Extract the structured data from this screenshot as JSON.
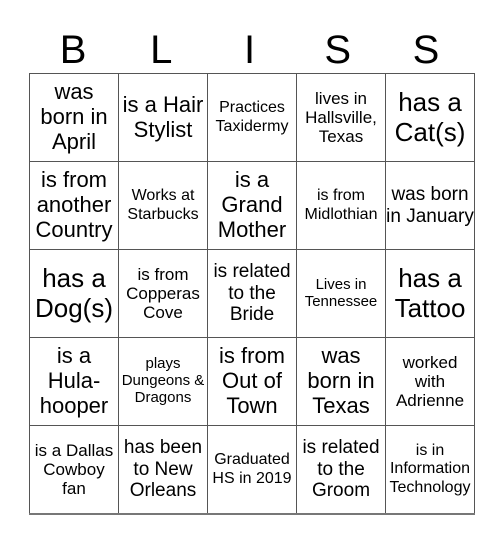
{
  "card": {
    "title_letters": [
      "B",
      "L",
      "I",
      "S",
      "S"
    ],
    "rows": [
      [
        {
          "text": "was born in April",
          "size": "l"
        },
        {
          "text": "is a Hair Stylist",
          "size": "l"
        },
        {
          "text": "Practices Taxidermy",
          "size": "xs"
        },
        {
          "text": "lives in Hallsville, Texas",
          "size": "s"
        },
        {
          "text": "has a Cat(s)",
          "size": "xl"
        }
      ],
      [
        {
          "text": "is from another Country",
          "size": "l"
        },
        {
          "text": "Works at Starbucks",
          "size": "xs"
        },
        {
          "text": "is a Grand Mother",
          "size": "l"
        },
        {
          "text": "is from Midlothian",
          "size": "xs"
        },
        {
          "text": "was born in January",
          "size": "m"
        }
      ],
      [
        {
          "text": "has a Dog(s)",
          "size": "xl"
        },
        {
          "text": "is from Copperas Cove",
          "size": "s"
        },
        {
          "text": "is related to the Bride",
          "size": "m"
        },
        {
          "text": "Lives in Tennessee",
          "size": "xxs"
        },
        {
          "text": "has a Tattoo",
          "size": "xl"
        }
      ],
      [
        {
          "text": "is a Hula-hooper",
          "size": "l"
        },
        {
          "text": "plays Dungeons & Dragons",
          "size": "xxs"
        },
        {
          "text": "is from Out of Town",
          "size": "l"
        },
        {
          "text": "was born in Texas",
          "size": "l"
        },
        {
          "text": "worked with Adrienne",
          "size": "s"
        }
      ],
      [
        {
          "text": "is a Dallas Cowboy fan",
          "size": "s"
        },
        {
          "text": "has been to New Orleans",
          "size": "m"
        },
        {
          "text": "Graduated HS in 2019",
          "size": "xs"
        },
        {
          "text": "is related to the Groom",
          "size": "m"
        },
        {
          "text": "is in Information Technology",
          "size": "xs"
        }
      ]
    ]
  }
}
